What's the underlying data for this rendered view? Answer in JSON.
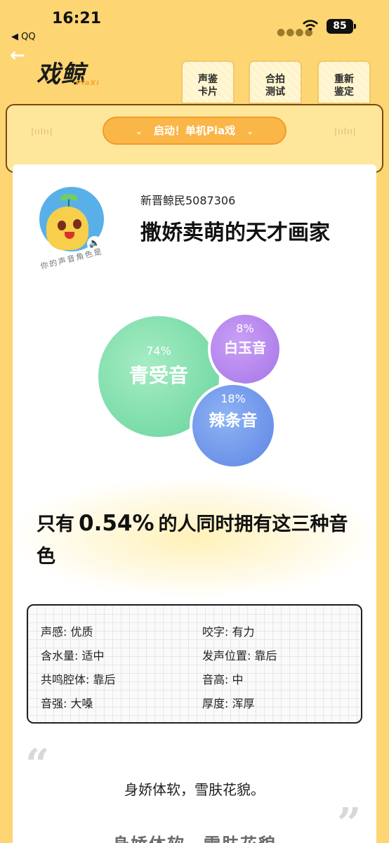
{
  "status_bar": {
    "time": "16:21",
    "back_app": "◀ QQ",
    "battery": "85"
  },
  "header": {
    "logo": "戏鲸",
    "logo_sub": "PiaXi",
    "tabs": [
      {
        "line1": "声鉴",
        "line2": "卡片"
      },
      {
        "line1": "合拍",
        "line2": "测试"
      },
      {
        "line1": "重新",
        "line2": "鉴定"
      }
    ]
  },
  "pia_button": {
    "label": "启动！单机Pia戏",
    "chevron": "⌄"
  },
  "profile": {
    "avatar_caption": "你的声音角色是",
    "username": "新晋鲸民5087306",
    "role_title": "撒娇卖萌的天才画家"
  },
  "voice_types": [
    {
      "name": "青受音",
      "percent": "74%",
      "color": "#66d49b"
    },
    {
      "name": "白玉音",
      "percent": "8%",
      "color": "#a774e8"
    },
    {
      "name": "辣条音",
      "percent": "18%",
      "color": "#5c85e2"
    }
  ],
  "rarity": {
    "prefix": "只有",
    "value": "0.54%",
    "suffix": "的人同时拥有这三种音色"
  },
  "attributes": [
    {
      "text": "声感: 优质"
    },
    {
      "text": "咬字: 有力"
    },
    {
      "text": "含水量: 适中"
    },
    {
      "text": "发声位置: 靠后"
    },
    {
      "text": "共鸣腔体: 靠后"
    },
    {
      "text": "音高: 中"
    },
    {
      "text": "音强: 大嗓"
    },
    {
      "text": "厚度: 浑厚"
    }
  ],
  "quote": {
    "open_mark": "“",
    "close_mark": "”",
    "text": "身娇体软，雪肤花貌。",
    "text_echo": "身娇体软，雪肤花貌"
  },
  "colors": {
    "background": "#fdd572",
    "accent_orange": "#fbb648",
    "highlight": "#f5c14a"
  }
}
